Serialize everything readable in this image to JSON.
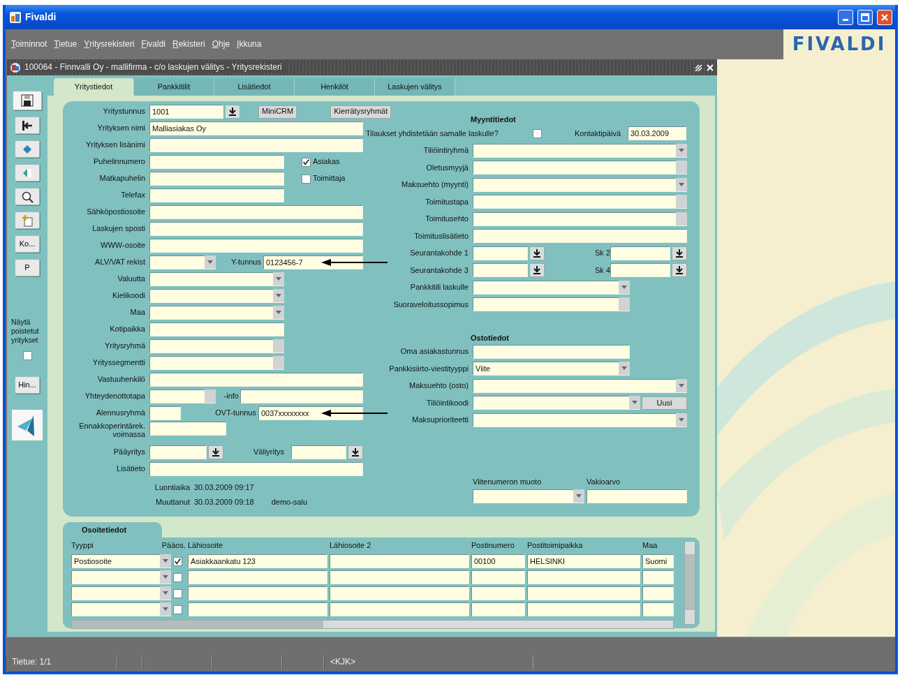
{
  "window": {
    "title": "Fivaldi"
  },
  "menu": [
    {
      "label": "Toiminnot"
    },
    {
      "label": "Tietue"
    },
    {
      "label": "Yritysrekisteri"
    },
    {
      "label": "Fivaldi"
    },
    {
      "label": "Rekisteri"
    },
    {
      "label": "Ohje"
    },
    {
      "label": "Ikkuna"
    }
  ],
  "logo": "FIVALDI",
  "form_window": {
    "title": "100064 - Finnvalli Oy - mallifirma - c/o laskujen välitys - Yritysrekisteri"
  },
  "toolbar": {
    "buttons": [
      "Ko...",
      "P"
    ],
    "show_deleted": {
      "label": "Näytä poistetut yritykset",
      "checked": false
    },
    "lower_buttons": [
      "Hin..."
    ]
  },
  "tabs": [
    {
      "label": "Yritystiedot",
      "selected": true
    },
    {
      "label": "Pankkitilit",
      "selected": false
    },
    {
      "label": "Lisätiedot",
      "selected": false
    },
    {
      "label": "Henkilöt",
      "selected": false
    },
    {
      "label": "Laskujen välitys",
      "selected": false
    }
  ],
  "company_form": {
    "left_rows": [
      {
        "label": "Yritystunnus",
        "items": [
          {
            "kind": "lov",
            "value": "1001"
          },
          {
            "kind": "button",
            "label": "MiniCRM"
          },
          {
            "kind": "button",
            "label": "Kierrätysryhmät"
          }
        ]
      },
      {
        "label": "Yrityksen nimi",
        "items": [
          {
            "kind": "text",
            "value": "Malliasiakas Oy"
          }
        ]
      },
      {
        "label": "Yrityksen lisänimi",
        "items": [
          {
            "kind": "text"
          }
        ]
      },
      {
        "label": "Puhelinnumero",
        "items": [
          {
            "kind": "text"
          },
          {
            "kind": "check",
            "label": "Asiakas",
            "checked": true
          }
        ]
      },
      {
        "label": "Matkapuhelin",
        "items": [
          {
            "kind": "text"
          },
          {
            "kind": "check",
            "label": "Toimittaja",
            "checked": false
          }
        ]
      },
      {
        "label": "Telefax",
        "items": [
          {
            "kind": "text"
          }
        ]
      },
      {
        "label": "Sähköpostiosoite",
        "items": [
          {
            "kind": "text"
          }
        ]
      },
      {
        "label": "Laskujen sposti",
        "items": [
          {
            "kind": "text"
          }
        ]
      },
      {
        "label": "WWW-osoite",
        "items": [
          {
            "kind": "text"
          }
        ]
      },
      {
        "label": "ALV/VAT rekist",
        "items": [
          {
            "kind": "combo"
          },
          {
            "kind": "label",
            "label": "Y-tunnus"
          },
          {
            "kind": "text",
            "value": "0123456-7",
            "pointer": true
          }
        ]
      },
      {
        "label": "Valuutta",
        "items": [
          {
            "kind": "combo"
          }
        ]
      },
      {
        "label": "Kielikoodi",
        "items": [
          {
            "kind": "combo"
          }
        ]
      },
      {
        "label": "Maa",
        "items": [
          {
            "kind": "combo"
          }
        ]
      },
      {
        "label": "Kotipaikka",
        "items": [
          {
            "kind": "text"
          }
        ]
      },
      {
        "label": "Yritysryhmä",
        "items": [
          {
            "kind": "list"
          }
        ]
      },
      {
        "label": "Yrityssegmentti",
        "items": [
          {
            "kind": "list"
          }
        ]
      },
      {
        "label": "Vastuuhenkilö",
        "items": [
          {
            "kind": "text"
          }
        ]
      },
      {
        "label": "Yhteydenottotapa",
        "items": [
          {
            "kind": "list"
          },
          {
            "kind": "label",
            "label": "-info"
          },
          {
            "kind": "text"
          }
        ]
      },
      {
        "label": "Alennusryhmä",
        "items": [
          {
            "kind": "text"
          },
          {
            "kind": "label",
            "label": "OVT-tunnus"
          },
          {
            "kind": "text",
            "value": "0037xxxxxxxx",
            "pointer": true
          }
        ]
      },
      {
        "label": "Ennakkoperintärek. voimassa",
        "items": [
          {
            "kind": "text"
          }
        ]
      },
      {
        "label": "Pääyritys",
        "items": [
          {
            "kind": "lov"
          },
          {
            "kind": "label",
            "label": "Väliyritys"
          },
          {
            "kind": "lov"
          }
        ]
      },
      {
        "label": "Lisätieto",
        "items": [
          {
            "kind": "text"
          }
        ]
      }
    ],
    "info": [
      {
        "label": "Luontiaika",
        "value": "30.03.2009 09:17"
      },
      {
        "label": "Muuttanut",
        "value": "30.03.2009 09:18",
        "user": "demo-salu"
      }
    ],
    "right_rows": [
      {
        "heading": "Myyntitiedot"
      },
      {
        "label": "Tilaukset yhdistetään samalle laskulle?",
        "items": [
          {
            "kind": "check",
            "checked": false
          },
          {
            "kind": "label",
            "label": "Kontaktipäivä"
          },
          {
            "kind": "text",
            "value": "30.03.2009"
          }
        ]
      },
      {
        "label": "Tiliöintiryhmä",
        "items": [
          {
            "kind": "combo"
          }
        ]
      },
      {
        "label": "Oletusmyyjä",
        "items": [
          {
            "kind": "list"
          }
        ]
      },
      {
        "label": "Maksuehto (myynti)",
        "items": [
          {
            "kind": "combo"
          }
        ]
      },
      {
        "label": "Toimitustapa",
        "items": [
          {
            "kind": "list"
          }
        ]
      },
      {
        "label": "Toimitusehto",
        "items": [
          {
            "kind": "list"
          }
        ]
      },
      {
        "label": "Toimituslisätieto",
        "items": [
          {
            "kind": "text"
          }
        ]
      },
      {
        "label": "Seurantakohde 1",
        "items": [
          {
            "kind": "lov"
          },
          {
            "kind": "label",
            "label": "Sk 2"
          },
          {
            "kind": "lov"
          }
        ]
      },
      {
        "label": "Seurantakohde 3",
        "items": [
          {
            "kind": "lov"
          },
          {
            "kind": "label",
            "label": "Sk 4"
          },
          {
            "kind": "lov"
          }
        ]
      },
      {
        "label": "Pankkitili laskulle",
        "items": [
          {
            "kind": "combo"
          }
        ]
      },
      {
        "label": "Suoraveloitussopimus",
        "items": [
          {
            "kind": "list"
          }
        ]
      },
      {
        "heading": "Ostotiedot"
      },
      {
        "label": "Oma asiakastunnus",
        "items": [
          {
            "kind": "text"
          }
        ]
      },
      {
        "label": "Pankkisiirto-viestityyppi",
        "items": [
          {
            "kind": "combo",
            "value": "Viite"
          }
        ]
      },
      {
        "label": "Maksuehto (osto)",
        "items": [
          {
            "kind": "combo"
          }
        ]
      },
      {
        "label": "Tiliöintikoodi",
        "items": [
          {
            "kind": "combo"
          },
          {
            "kind": "button",
            "label": "Uusi"
          }
        ]
      },
      {
        "label": "Maksuprioriteetti",
        "items": [
          {
            "kind": "combo"
          }
        ]
      }
    ],
    "reference": [
      {
        "label": "Viitenumeron muoto",
        "kind": "combo"
      },
      {
        "label": "Vakioarvo",
        "kind": "text"
      }
    ]
  },
  "addresses": {
    "title": "Osoitetiedot",
    "columns": [
      "Tyyppi",
      "Pääos.",
      "Lähiosoite",
      "Lähiosoite 2",
      "Postinumero",
      "Postitoimipaikka",
      "Maa"
    ],
    "rows": [
      {
        "type": "Postiosoite",
        "primary": true,
        "street": "Asiakkaankatu 123",
        "postcode": "00100",
        "city": "HELSINKI",
        "country": "Suomi"
      },
      {
        "primary": false
      },
      {
        "primary": false
      },
      {
        "primary": false
      }
    ]
  },
  "status_bar": {
    "record": "Tietue: 1/1",
    "mode": "<KJK>"
  }
}
